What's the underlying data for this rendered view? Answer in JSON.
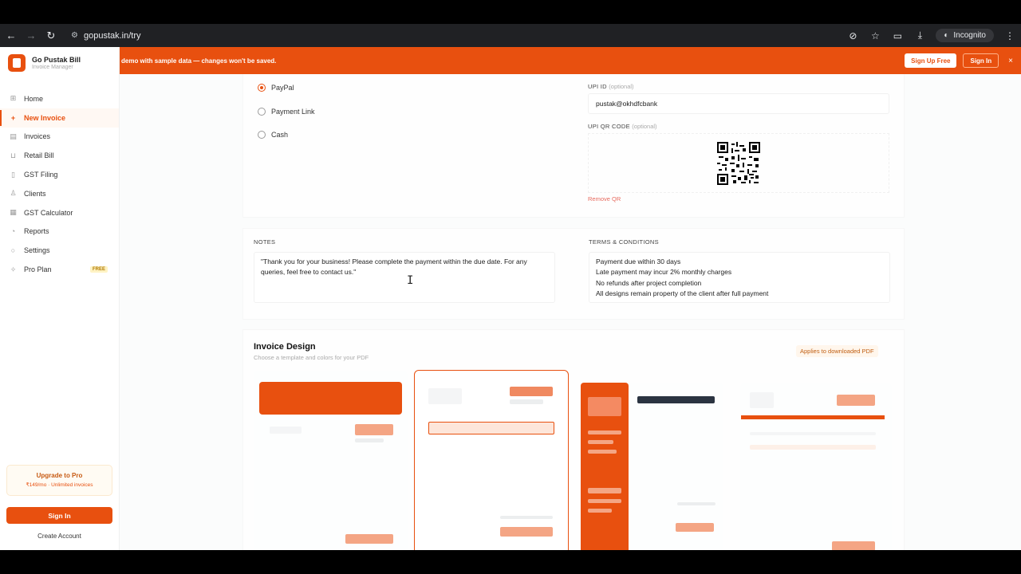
{
  "browser": {
    "url": "gopustak.in/try",
    "incognito_label": "Incognito"
  },
  "sidebar": {
    "brand_name": "Go Pustak Bill",
    "brand_sub": "Invoice Manager",
    "items": [
      {
        "label": "Home",
        "icon": "grid-icon"
      },
      {
        "label": "New Invoice",
        "icon": "plus-icon"
      },
      {
        "label": "Invoices",
        "icon": "file-icon"
      },
      {
        "label": "Retail Bill",
        "icon": "cart-icon"
      },
      {
        "label": "GST Filing",
        "icon": "document-icon"
      },
      {
        "label": "Clients",
        "icon": "user-icon"
      },
      {
        "label": "GST Calculator",
        "icon": "calculator-icon"
      },
      {
        "label": "Reports",
        "icon": "pie-icon"
      },
      {
        "label": "Settings",
        "icon": "gear-icon"
      },
      {
        "label": "Pro Plan",
        "icon": "sparkle-icon",
        "badge": "FREE"
      }
    ],
    "active_item": "New Invoice",
    "upgrade_title": "Upgrade to Pro",
    "upgrade_sub": "₹149/mo · Unlimited invoices",
    "signin_label": "Sign In",
    "create_account_label": "Create Account"
  },
  "banner": {
    "message": "demo with sample data — changes won't be saved.",
    "signup_label": "Sign Up Free",
    "signin_label": "Sign In",
    "close_symbol": "×"
  },
  "payment": {
    "methods": [
      {
        "label": "PayPal",
        "selected": true
      },
      {
        "label": "Payment Link",
        "selected": false
      },
      {
        "label": "Cash",
        "selected": false
      }
    ],
    "upi_id_label": "UPI ID",
    "upi_id_optional": "(optional)",
    "upi_id_value": "pustak@okhdfcbank",
    "upi_qr_label": "UPI QR CODE",
    "upi_qr_optional": "(optional)",
    "remove_qr_label": "Remove QR"
  },
  "notes": {
    "label": "NOTES",
    "value": "\"Thank you for your business! Please complete the payment within the due date. For any queries, feel free to contact us.\""
  },
  "terms": {
    "label": "TERMS & CONDITIONS",
    "lines": [
      "Payment due within 30 days",
      "Late payment may incur 2% monthly charges",
      "No refunds after project completion",
      "All designs remain property of the client after full payment"
    ]
  },
  "design": {
    "title": "Invoice Design",
    "subtitle": "Choose a template and colors for your PDF",
    "applies_label": "Applies to downloaded PDF",
    "accent": "#e8500f",
    "selected_template_index": 1
  }
}
